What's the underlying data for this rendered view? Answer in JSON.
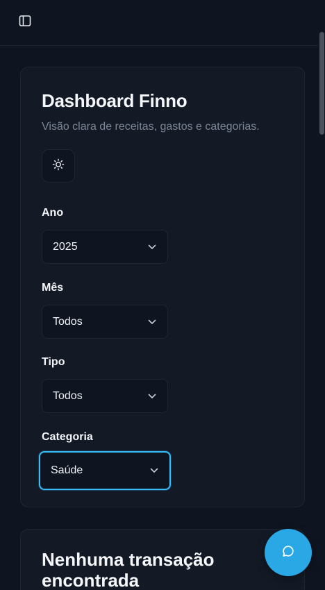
{
  "header": {
    "sidebar_toggle_icon": "sidebar-panel-icon"
  },
  "dashboard": {
    "title": "Dashboard Finno",
    "subtitle": "Visão clara de receitas, gastos e categorias.",
    "theme_toggle_icon": "sun-icon"
  },
  "filters": {
    "year": {
      "label": "Ano",
      "value": "2025"
    },
    "month": {
      "label": "Mês",
      "value": "Todos"
    },
    "type": {
      "label": "Tipo",
      "value": "Todos"
    },
    "category": {
      "label": "Categoria",
      "value": "Saúde"
    }
  },
  "empty_state": {
    "title": "Nenhuma transação encontrada"
  },
  "chat": {
    "icon": "chat-bubble-icon"
  },
  "colors": {
    "accent": "#38bdf8",
    "fab": "#2aa8e6",
    "background": "#0f1520",
    "card": "#131a26"
  }
}
